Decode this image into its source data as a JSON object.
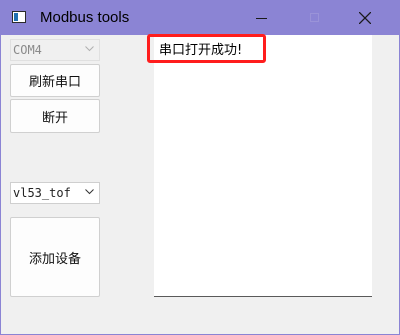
{
  "window": {
    "title": "Modbus tools"
  },
  "titlebar": {
    "icon": "app-window-icon",
    "minimize": "minimize-icon",
    "maximize": "maximize-icon",
    "close": "close-icon"
  },
  "controls": {
    "port_select": {
      "value": "COM4",
      "enabled": false
    },
    "refresh_button": "刷新串口",
    "disconnect_button": "断开",
    "device_select": {
      "value": "vl53_tof"
    },
    "add_device_button": "添加设备"
  },
  "log": {
    "message": "串口打开成功!"
  },
  "colors": {
    "titlebar": "#8b84d4",
    "highlight": "#ff1d1d",
    "background": "#f0f0f0"
  }
}
